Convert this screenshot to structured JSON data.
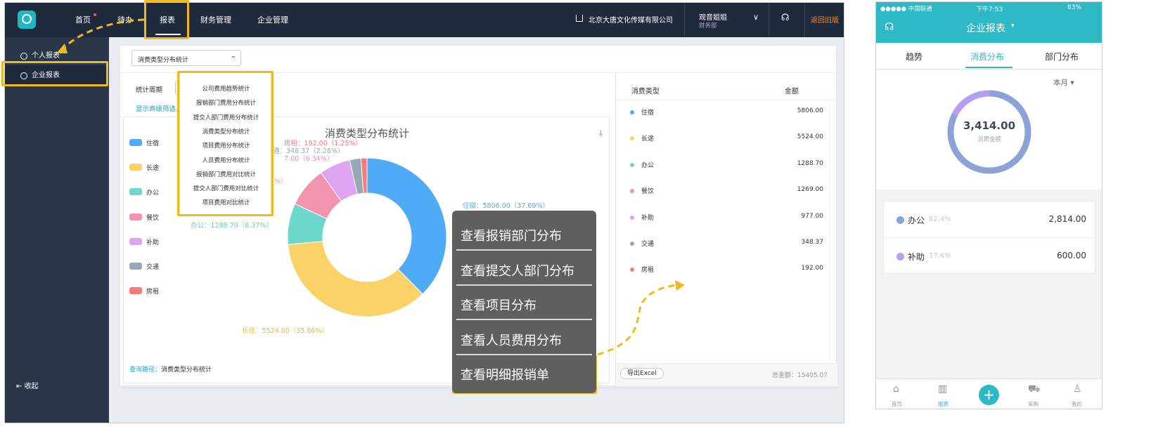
{
  "desktop": {
    "nav": [
      "首页",
      "待办",
      "报表",
      "财务管理",
      "企业管理"
    ],
    "company": "北京大唐文化传媒有限公司",
    "user_name": "观音姐姐",
    "user_dept": "财务部",
    "return_old": "返回旧版",
    "sidebar": [
      "个人报表",
      "企业报表"
    ],
    "collapse": "收起",
    "report_select": "消费类型分布统计",
    "period_label": "统计周期",
    "advanced": "显示高级筛选..",
    "dropdown": [
      "公司费用趋势统计",
      "报销部门费用分布统计",
      "提交人部门费用分布统计",
      "消费类型分布统计",
      "项目费用分布统计",
      "人员费用分布统计",
      "报销部门费用对比统计",
      "提交人部门费用对比统计",
      "项目费用对比统计"
    ],
    "query_path_label": "查询路径：",
    "query_path": "消费类型分布统计",
    "table_header": [
      "消费类型",
      "金额"
    ],
    "export": "导出Excel",
    "total": "总金额：15405.07",
    "context_menu": [
      "查看报销部门分布",
      "查看提交人部门分布",
      "查看项目分布",
      "查看人员费用分布",
      "查看明细报销单"
    ],
    "slice_labels": [
      "住宿：5806.00（37.69%）",
      "长途：5524.00（35.86%）",
      "办公：1288.70（8.37%）",
      "%）",
      "7.00（6.34%）",
      "通：348.37（2.26%）",
      "房租：192.00（1.25%）"
    ]
  },
  "chart_data": {
    "type": "pie",
    "title": "消费类型分布统计",
    "categories": [
      "住宿",
      "长途",
      "办公",
      "餐饮",
      "补助",
      "交通",
      "房租"
    ],
    "values": [
      5806.0,
      5524.0,
      1288.7,
      1269.0,
      977.0,
      348.37,
      192.0
    ],
    "value_labels": [
      "5806.00",
      "5524.00",
      "1288.70",
      "1269.00",
      "977.00",
      "348.37",
      "192.00"
    ],
    "colors": [
      "#4fabf5",
      "#fbd266",
      "#6ed7cc",
      "#f493ad",
      "#dea4f2",
      "#95a9b6",
      "#f77b7b"
    ],
    "legend": "left",
    "donut": true
  },
  "phone": {
    "status": {
      "carrier": "●●●●● 中国联通",
      "time": "下午7:53",
      "battery": "83%"
    },
    "title": "企业报表",
    "tabs": [
      "趋势",
      "消费分布",
      "部门分布"
    ],
    "period": "本月",
    "center_value": "3,414.00",
    "center_label": "消费金额",
    "rows": [
      {
        "name": "办公",
        "pct": "82.4%",
        "value": "2,814.00",
        "color": "#8da3d7"
      },
      {
        "name": "补助",
        "pct": "17.6%",
        "value": "600.00",
        "color": "#b89ef2"
      }
    ],
    "bottom": [
      "首页",
      "报表",
      "采购",
      "我的"
    ],
    "ring": {
      "values": [
        82.4,
        17.6
      ],
      "colors": [
        "#8da3d7",
        "#b89ef2"
      ]
    }
  }
}
